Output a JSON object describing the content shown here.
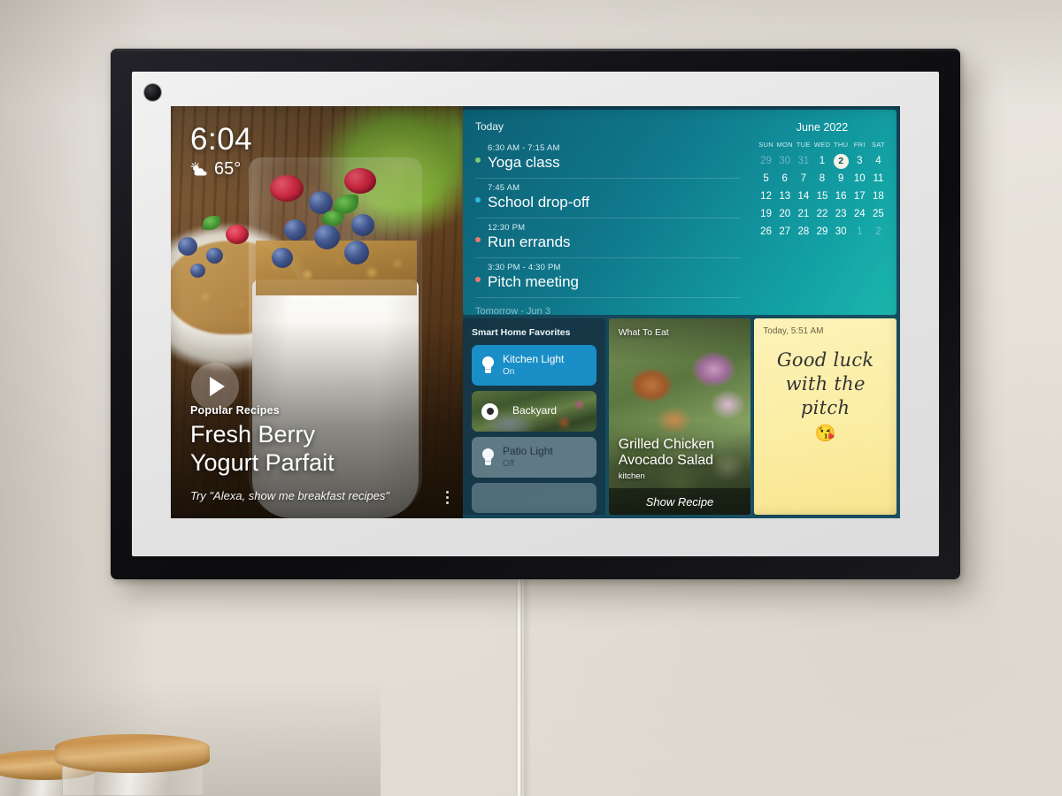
{
  "device": {
    "name": "smart-display",
    "camera_icon": "camera-dot"
  },
  "hero": {
    "clock": "6:04",
    "temperature": "65°",
    "weather_icon": "partly-cloudy-icon",
    "play_icon": "play-icon",
    "eyebrow": "Popular Recipes",
    "title_line1": "Fresh Berry",
    "title_line2": "Yogurt Parfait",
    "hint": "Try \"Alexa, show me breakfast recipes\"",
    "overflow_icon": "more-vertical-icon"
  },
  "agenda": {
    "header": "Today",
    "next_day_label": "Tomorrow - Jun 3",
    "events": [
      {
        "time": "6:30 AM - 7:15 AM",
        "title": "Yoga class",
        "dot_color": "#7bc96f"
      },
      {
        "time": "7:45 AM",
        "title": "School drop-off",
        "dot_color": "#35b8e0"
      },
      {
        "time": "12:30 PM",
        "title": "Run errands",
        "dot_color": "#f07a6a"
      },
      {
        "time": "3:30 PM - 4:30 PM",
        "title": "Pitch meeting",
        "dot_color": "#f07a6a"
      }
    ]
  },
  "calendar": {
    "month_label": "June 2022",
    "day_headers": [
      "SUN",
      "MON",
      "TUE",
      "WED",
      "THU",
      "FRI",
      "SAT"
    ],
    "today": 2,
    "weeks": [
      [
        {
          "d": "29",
          "m": true
        },
        {
          "d": "30",
          "m": true
        },
        {
          "d": "31",
          "m": true
        },
        {
          "d": "1",
          "m": false
        },
        {
          "d": "2",
          "m": false,
          "today": true
        },
        {
          "d": "3",
          "m": false
        },
        {
          "d": "4",
          "m": false
        }
      ],
      [
        {
          "d": "5",
          "m": false
        },
        {
          "d": "6",
          "m": false
        },
        {
          "d": "7",
          "m": false
        },
        {
          "d": "8",
          "m": false
        },
        {
          "d": "9",
          "m": false
        },
        {
          "d": "10",
          "m": false
        },
        {
          "d": "11",
          "m": false
        }
      ],
      [
        {
          "d": "12",
          "m": false
        },
        {
          "d": "13",
          "m": false
        },
        {
          "d": "14",
          "m": false
        },
        {
          "d": "15",
          "m": false
        },
        {
          "d": "16",
          "m": false
        },
        {
          "d": "17",
          "m": false
        },
        {
          "d": "18",
          "m": false
        }
      ],
      [
        {
          "d": "19",
          "m": false
        },
        {
          "d": "20",
          "m": false
        },
        {
          "d": "21",
          "m": false
        },
        {
          "d": "22",
          "m": false
        },
        {
          "d": "23",
          "m": false
        },
        {
          "d": "24",
          "m": false
        },
        {
          "d": "25",
          "m": false
        }
      ],
      [
        {
          "d": "26",
          "m": false
        },
        {
          "d": "27",
          "m": false
        },
        {
          "d": "28",
          "m": false
        },
        {
          "d": "29",
          "m": false
        },
        {
          "d": "30",
          "m": false
        },
        {
          "d": "1",
          "m": true
        },
        {
          "d": "2",
          "m": true
        }
      ]
    ]
  },
  "smart_home": {
    "title": "Smart Home Favorites",
    "devices": [
      {
        "label": "Kitchen Light",
        "state": "On",
        "type": "light",
        "active": true,
        "icon": "lightbulb-icon"
      },
      {
        "label": "Backyard",
        "state": "",
        "type": "camera",
        "active": false,
        "icon": "camera-icon"
      },
      {
        "label": "Patio Light",
        "state": "Off",
        "type": "light",
        "active": false,
        "icon": "lightbulb-icon"
      }
    ],
    "accent_on": "#1a8ec6"
  },
  "recipe_card": {
    "eyebrow": "What To Eat",
    "title_line1": "Grilled Chicken",
    "title_line2": "Avocado Salad",
    "source": "kitchen",
    "cta": "Show Recipe"
  },
  "sticky_note": {
    "timestamp": "Today, 5:51 AM",
    "line1": "Good luck",
    "line2": "with the",
    "line3": "pitch",
    "emoji": "😘",
    "color": "#fbeda2"
  }
}
